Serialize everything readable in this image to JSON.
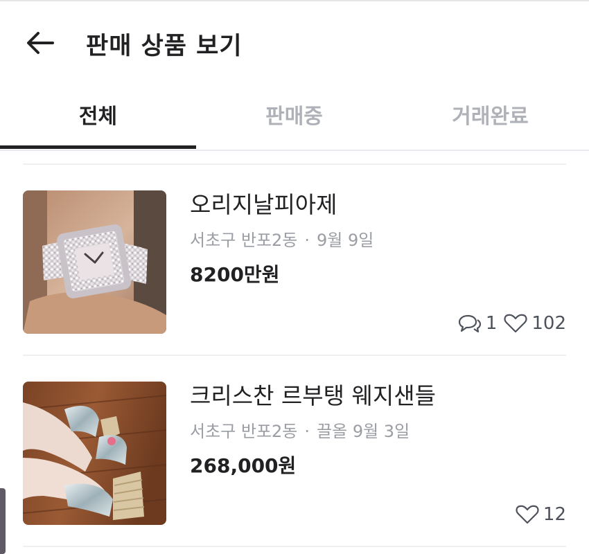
{
  "header": {
    "back_icon": "arrow-left-icon",
    "title": "판매 상품 보기"
  },
  "tabs": [
    {
      "label": "전체",
      "active": true
    },
    {
      "label": "판매중",
      "active": false
    },
    {
      "label": "거래완료",
      "active": false
    }
  ],
  "items": [
    {
      "title": "오리지날피아제",
      "location": "서초구 반포2동",
      "time": "9월 9일",
      "price": "8200만원",
      "chats": "1",
      "likes": "102",
      "image": "diamond-watch-photo"
    },
    {
      "title": "크리스찬 르부탱 웨지샌들",
      "location": "서초구 반포2동",
      "time": "끌올 9월 3일",
      "price": "268,000원",
      "likes": "12",
      "image": "silver-wedge-sandals-photo"
    }
  ],
  "colors": {
    "active_text": "#212124",
    "inactive_tab": "#aeb2b8",
    "meta_text": "#9a9ea4",
    "divider": "#eeeff1"
  }
}
